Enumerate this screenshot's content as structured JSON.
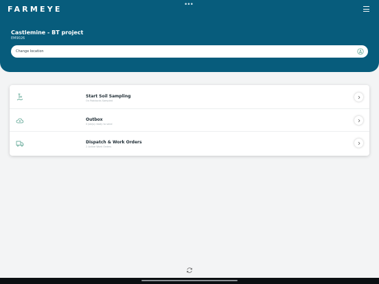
{
  "app": {
    "logo": "FARMEYE"
  },
  "project": {
    "title": "Castlemine - BT project",
    "code": "EM9026"
  },
  "location": {
    "label": "Change location"
  },
  "menu": [
    {
      "title": "Start Soil Sampling",
      "subtitle": "On Paddocks Sampled",
      "icon": "soil-probe-icon"
    },
    {
      "title": "Outbox",
      "subtitle": "0 Job(s) ready to send",
      "icon": "cloud-upload-icon"
    },
    {
      "title": "Dispatch & Work Orders",
      "subtitle": "2 Active Work Orders",
      "icon": "truck-icon"
    }
  ],
  "colors": {
    "header": "#075c7c",
    "background": "#f3f4f5",
    "card": "#ffffff"
  }
}
